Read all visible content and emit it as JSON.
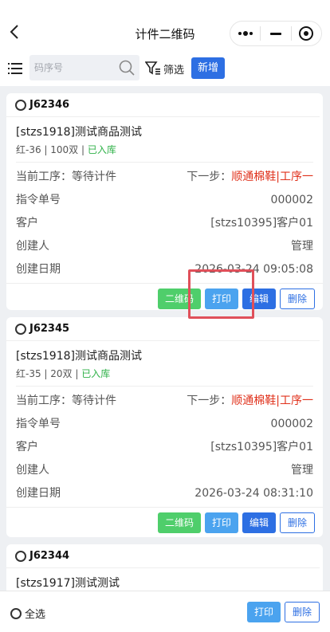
{
  "header": {
    "title": "计件二维码"
  },
  "toolbar": {
    "search_placeholder": "码序号",
    "filter_label": "筛选",
    "add_label": "新增"
  },
  "cards": [
    {
      "code": "J62346",
      "product": "[stzs1918]测试商品测试",
      "meta_spec": "红-36 | 100双 | ",
      "meta_status": "已入库",
      "process_label": "当前工序：等待计件",
      "next_label": "下一步：",
      "next_value": "顺通棉鞋|工序一",
      "order_label": "指令单号",
      "order_value": "000002",
      "customer_label": "客户",
      "customer_value": "[stzs10395]客户01",
      "creator_label": "创建人",
      "creator_value": "管理",
      "date_label": "创建日期",
      "date_value": "2026-03-24 09:05:08"
    },
    {
      "code": "J62345",
      "product": "[stzs1918]测试商品测试",
      "meta_spec": "红-35 | 20双 | ",
      "meta_status": "已入库",
      "process_label": "当前工序：等待计件",
      "next_label": "下一步：",
      "next_value": "顺通棉鞋|工序一",
      "order_label": "指令单号",
      "order_value": "000002",
      "customer_label": "客户",
      "customer_value": "[stzs10395]客户01",
      "creator_label": "创建人",
      "creator_value": "管理",
      "date_label": "创建日期",
      "date_value": "2026-03-24 08:31:10"
    },
    {
      "code": "J62344",
      "product": "[stzs1917]测试测试"
    }
  ],
  "actions": {
    "qr": "二维码",
    "print": "打印",
    "edit": "编辑",
    "delete": "删除"
  },
  "bottom": {
    "select_all": "全选",
    "print": "打印",
    "delete": "删除"
  },
  "colors": {
    "primary": "#2d6fe3",
    "print": "#4ba3ef",
    "qr": "#4fce6b",
    "status_green": "#31b24a",
    "next_red": "#e0321c"
  }
}
